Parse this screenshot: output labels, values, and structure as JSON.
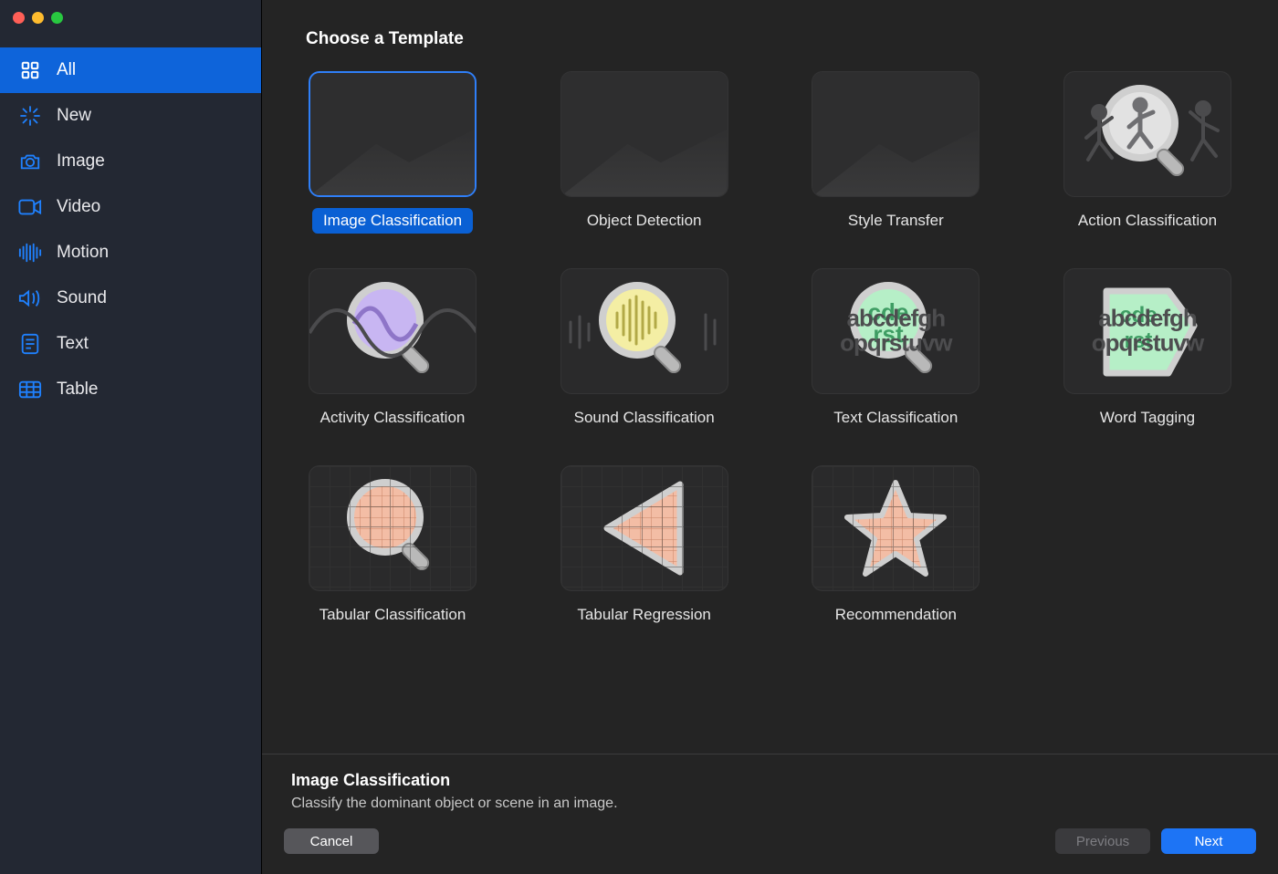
{
  "heading": "Choose a Template",
  "sidebar": {
    "items": [
      {
        "label": "All",
        "icon": "grid-icon",
        "selected": true
      },
      {
        "label": "New",
        "icon": "sparkle-icon",
        "selected": false
      },
      {
        "label": "Image",
        "icon": "camera-icon",
        "selected": false
      },
      {
        "label": "Video",
        "icon": "video-icon",
        "selected": false
      },
      {
        "label": "Motion",
        "icon": "wave-icon",
        "selected": false
      },
      {
        "label": "Sound",
        "icon": "speaker-icon",
        "selected": false
      },
      {
        "label": "Text",
        "icon": "document-icon",
        "selected": false
      },
      {
        "label": "Table",
        "icon": "table-icon",
        "selected": false
      }
    ]
  },
  "templates": [
    {
      "label": "Image Classification",
      "icon": "image-magnifier-icon",
      "selected": true
    },
    {
      "label": "Object Detection",
      "icon": "object-detection-icon",
      "selected": false
    },
    {
      "label": "Style Transfer",
      "icon": "style-transfer-icon",
      "selected": false
    },
    {
      "label": "Action Classification",
      "icon": "action-magnifier-icon",
      "selected": false
    },
    {
      "label": "Activity Classification",
      "icon": "activity-magnifier-icon",
      "selected": false
    },
    {
      "label": "Sound Classification",
      "icon": "sound-magnifier-icon",
      "selected": false
    },
    {
      "label": "Text Classification",
      "icon": "text-magnifier-icon",
      "selected": false
    },
    {
      "label": "Word Tagging",
      "icon": "tag-icon",
      "selected": false
    },
    {
      "label": "Tabular Classification",
      "icon": "table-magnifier-icon",
      "selected": false
    },
    {
      "label": "Tabular Regression",
      "icon": "table-regression-icon",
      "selected": false
    },
    {
      "label": "Recommendation",
      "icon": "star-icon",
      "selected": false
    }
  ],
  "info": {
    "title": "Image Classification",
    "desc": "Classify the dominant object or scene in an image."
  },
  "buttons": {
    "cancel": "Cancel",
    "previous": "Previous",
    "next": "Next"
  }
}
